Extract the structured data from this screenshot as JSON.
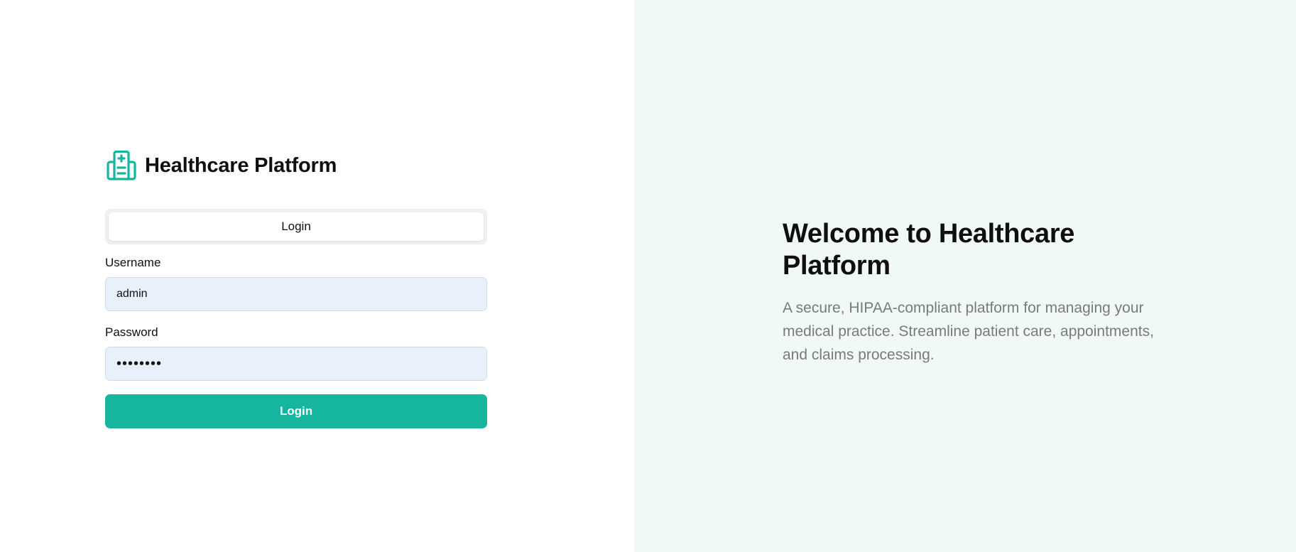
{
  "brand": {
    "title": "Healthcare Platform",
    "icon": "hospital-icon",
    "accent_color": "#16b59e"
  },
  "tabs": [
    {
      "label": "Login",
      "active": true
    }
  ],
  "form": {
    "username": {
      "label": "Username",
      "value": "admin",
      "placeholder": ""
    },
    "password": {
      "label": "Password",
      "value": "••••••••",
      "placeholder": ""
    },
    "submit_label": "Login"
  },
  "welcome": {
    "title": "Welcome to Healthcare Platform",
    "description": "A secure, HIPAA-compliant platform for managing your medical practice. Streamline patient care, appointments, and claims processing."
  },
  "colors": {
    "right_panel_bg": "#f1f9f7",
    "input_bg": "#e8f0fc",
    "button_bg": "#16b59e"
  }
}
